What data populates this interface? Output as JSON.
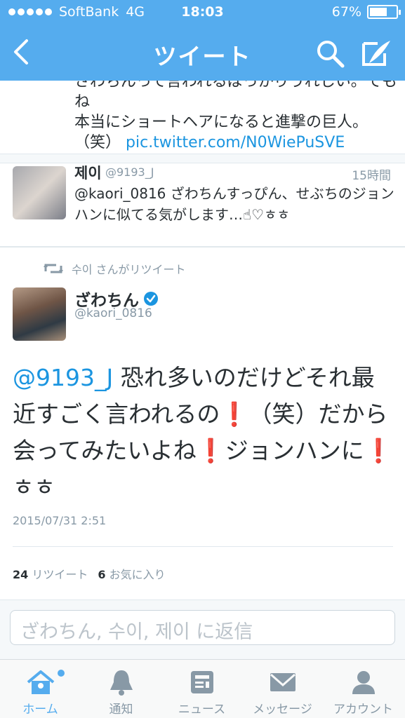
{
  "status_bar": {
    "carrier": "SoftBank",
    "network": "4G",
    "time": "18:03",
    "battery": "67%",
    "battery_level": 0.67
  },
  "nav": {
    "title": "ツイート",
    "back_icon": "chevron-left-icon",
    "search_icon": "search-icon",
    "compose_icon": "compose-icon"
  },
  "previous_tweet": {
    "line1": "さわちんって言われるばっかりうれしい。でもね",
    "line2": "本当にショートヘアになると進撃の巨人。",
    "line3_prefix": "（笑）",
    "link": "pic.twitter.com/N0WiePuSVE"
  },
  "reply_tweet": {
    "name": "제이",
    "handle": "@9193_J",
    "time": "15時間",
    "text": "@kaori_0816 ざわちんすっぴん、せぶちのジョンハンに似てる気がします…☝♡ㅎㅎ"
  },
  "main_tweet": {
    "retweeted_by": "수이 さんがリツイート",
    "name": "ざわちん",
    "handle": "@kaori_0816",
    "mention": "@9193_J",
    "text_part1": " 恐れ多いのだけどそれ最近すごく言われるの",
    "text_part2": "（笑）だから会ってみたいよね",
    "text_part3": "ジョンハンに",
    "text_part4": "ㅎㅎ",
    "exclamation": "❗",
    "date": "2015/07/31 2:51",
    "retweet_count": "24",
    "retweet_label": "リツイート",
    "favorite_count": "6",
    "favorite_label": "お気に入り"
  },
  "reply_box": {
    "placeholder": "ざわちん, 수이, 제이 に返信"
  },
  "tabs": [
    {
      "label": "ホーム",
      "icon": "home-icon",
      "active": true
    },
    {
      "label": "通知",
      "icon": "bell-icon",
      "active": false
    },
    {
      "label": "ニュース",
      "icon": "news-icon",
      "active": false
    },
    {
      "label": "メッセージ",
      "icon": "envelope-icon",
      "active": false
    },
    {
      "label": "アカウント",
      "icon": "person-icon",
      "active": false
    }
  ],
  "colors": {
    "brand": "#55acee",
    "link": "#1b95e0",
    "muted": "#8899a6",
    "exclamation": "#d0202d"
  }
}
